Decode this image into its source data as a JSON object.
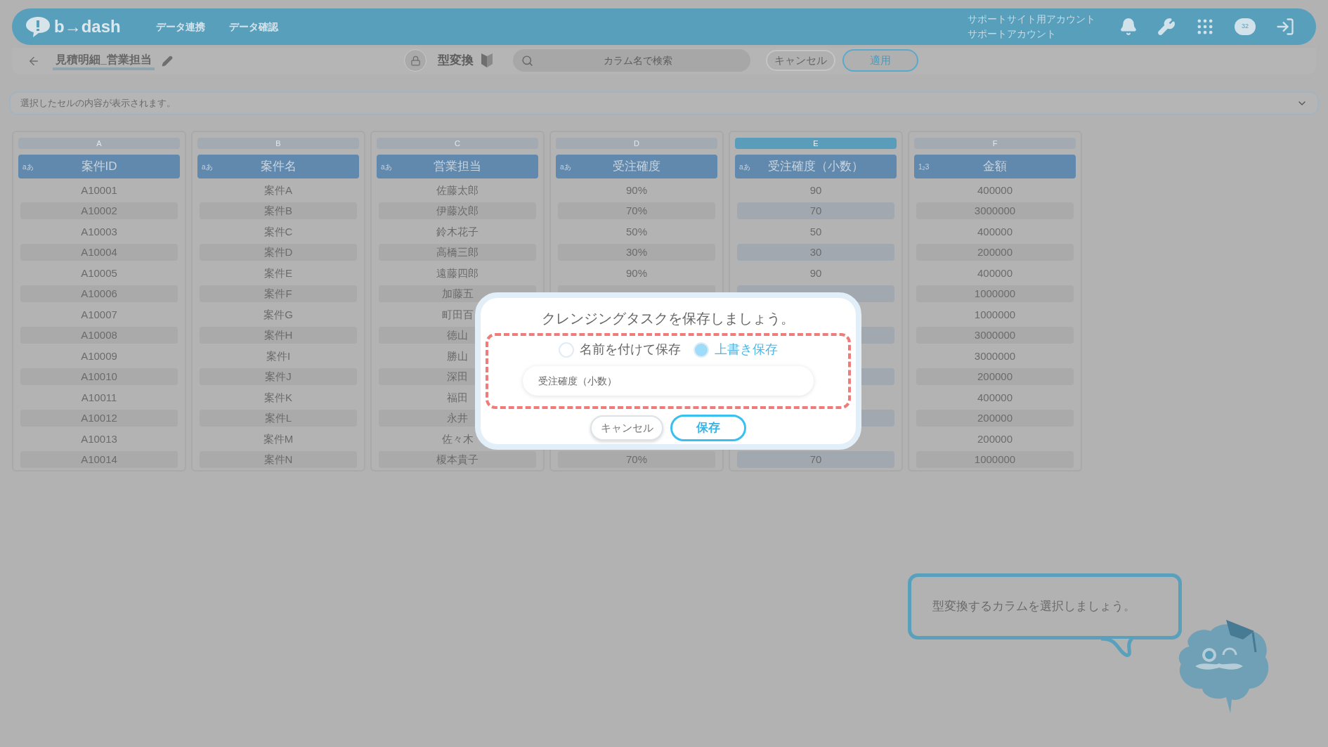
{
  "header": {
    "logo": "b→dash",
    "nav": [
      {
        "label": "データ連携"
      },
      {
        "label": "データ確認"
      }
    ],
    "account": [
      "サポートサイト用アカウント",
      "サポートアカウント"
    ],
    "chat_badge": "32"
  },
  "toolbar": {
    "title": "見積明細_営業担当",
    "mode": "型変換",
    "search": {
      "placeholder": "カラム名で検索"
    },
    "cancel": "キャンセル",
    "apply": "適用"
  },
  "cell_bar": {
    "placeholder": "選択したセルの内容が表示されます。"
  },
  "columns": [
    {
      "letter": "A",
      "selected": false,
      "type_label": "aあ",
      "name": "案件ID",
      "cells": [
        "A10001",
        "A10002",
        "A10003",
        "A10004",
        "A10005",
        "A10006",
        "A10007",
        "A10008",
        "A10009",
        "A10010",
        "A10011",
        "A10012",
        "A10013",
        "A10014"
      ]
    },
    {
      "letter": "B",
      "selected": false,
      "type_label": "aあ",
      "name": "案件名",
      "cells": [
        "案件A",
        "案件B",
        "案件C",
        "案件D",
        "案件E",
        "案件F",
        "案件G",
        "案件H",
        "案件I",
        "案件J",
        "案件K",
        "案件L",
        "案件M",
        "案件N"
      ]
    },
    {
      "letter": "C",
      "selected": false,
      "type_label": "aあ",
      "name": "営業担当",
      "cells": [
        "佐藤太郎",
        "伊藤次郎",
        "鈴木花子",
        "高橋三郎",
        "遠藤四郎",
        "加藤五",
        "町田百",
        "徳山",
        "勝山",
        "深田",
        "福田",
        "永井",
        "佐々木",
        "榎本貴子"
      ]
    },
    {
      "letter": "D",
      "selected": false,
      "type_label": "aあ",
      "name": "受注確度",
      "cells": [
        "90%",
        "70%",
        "50%",
        "30%",
        "90%",
        null,
        null,
        null,
        null,
        null,
        null,
        null,
        null,
        "70%"
      ]
    },
    {
      "letter": "E",
      "selected": true,
      "type_label": "aあ",
      "name": "受注確度（小数）",
      "cells": [
        "90",
        "70",
        "50",
        "30",
        "90",
        null,
        null,
        null,
        null,
        null,
        null,
        null,
        null,
        "70"
      ]
    },
    {
      "letter": "F",
      "selected": false,
      "type_label": "1$_{2}$3",
      "name": "金額",
      "cells": [
        "400000",
        "3000000",
        "400000",
        "200000",
        "400000",
        "1000000",
        "1000000",
        "3000000",
        "3000000",
        "200000",
        "400000",
        "200000",
        "200000",
        "1000000"
      ]
    }
  ],
  "dialog": {
    "title": "クレンジングタスクを保存しましょう。",
    "options": [
      {
        "label": "名前を付けて保存",
        "selected": false
      },
      {
        "label": "上書き保存",
        "selected": true
      }
    ],
    "name_field": {
      "value": "受注確度（小数）"
    },
    "cancel": "キャンセル",
    "save": "保存"
  },
  "guide": {
    "message": "型変換するカラムを選択しましょう。"
  }
}
